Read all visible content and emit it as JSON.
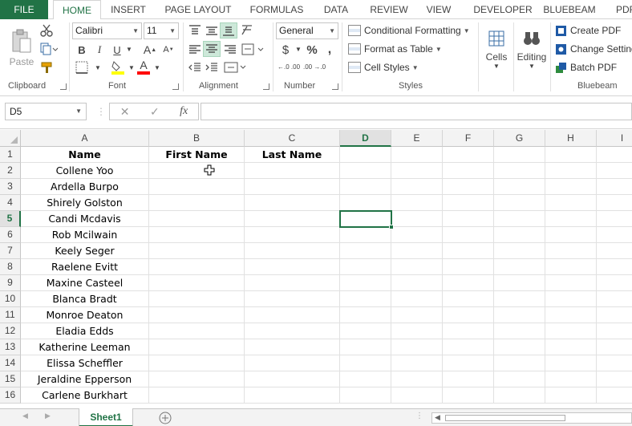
{
  "ribbon_tabs": [
    "FILE",
    "HOME",
    "INSERT",
    "PAGE LAYOUT",
    "FORMULAS",
    "DATA",
    "REVIEW",
    "VIEW",
    "DEVELOPER",
    "BLUEBEAM",
    "PDF"
  ],
  "active_tab": "HOME",
  "clipboard": {
    "paste_label": "Paste",
    "group_label": "Clipboard"
  },
  "font": {
    "name": "Calibri",
    "size": "11",
    "group_label": "Font",
    "bold": "B",
    "italic": "I",
    "underline": "U",
    "grow": "A",
    "fill_color": "#ffff00",
    "font_color": "#ff0000"
  },
  "alignment": {
    "group_label": "Alignment"
  },
  "number": {
    "format": "General",
    "currency": "$",
    "percent": "%",
    "comma": ",",
    "inc_dec": "←.0 .00",
    "dec_dec": ".00 →.0",
    "group_label": "Number"
  },
  "styles": {
    "conditional": "Conditional Formatting",
    "table": "Format as Table",
    "cell_styles": "Cell Styles",
    "group_label": "Styles"
  },
  "cells": {
    "label": "Cells"
  },
  "editing": {
    "label": "Editing"
  },
  "bluebeam": {
    "create": "Create PDF",
    "change": "Change Settings",
    "batch": "Batch PDF",
    "group_label": "Bluebeam"
  },
  "formula_bar": {
    "name_box": "D5",
    "cancel": "✕",
    "enter": "✓",
    "fx": "fx",
    "value": ""
  },
  "columns": [
    "A",
    "B",
    "C",
    "D",
    "E",
    "F",
    "G",
    "H",
    "I"
  ],
  "active_column": "D",
  "active_row": "5",
  "rows": [
    {
      "num": "1",
      "a": "Name",
      "b": "First Name",
      "c": "Last Name"
    },
    {
      "num": "2",
      "a": "Collene Yoo",
      "b": "",
      "c": ""
    },
    {
      "num": "3",
      "a": "Ardella Burpo",
      "b": "",
      "c": ""
    },
    {
      "num": "4",
      "a": "Shirely Golston",
      "b": "",
      "c": ""
    },
    {
      "num": "5",
      "a": "Candi Mcdavis",
      "b": "",
      "c": ""
    },
    {
      "num": "6",
      "a": "Rob Mcilwain",
      "b": "",
      "c": ""
    },
    {
      "num": "7",
      "a": "Keely Seger",
      "b": "",
      "c": ""
    },
    {
      "num": "8",
      "a": "Raelene Evitt",
      "b": "",
      "c": ""
    },
    {
      "num": "9",
      "a": "Maxine Casteel",
      "b": "",
      "c": ""
    },
    {
      "num": "10",
      "a": "Blanca Bradt",
      "b": "",
      "c": ""
    },
    {
      "num": "11",
      "a": "Monroe Deaton",
      "b": "",
      "c": ""
    },
    {
      "num": "12",
      "a": "Eladia Edds",
      "b": "",
      "c": ""
    },
    {
      "num": "13",
      "a": "Katherine Leeman",
      "b": "",
      "c": ""
    },
    {
      "num": "14",
      "a": "Elissa Scheffler",
      "b": "",
      "c": ""
    },
    {
      "num": "15",
      "a": "Jeraldine Epperson",
      "b": "",
      "c": ""
    },
    {
      "num": "16",
      "a": "Carlene Burkhart",
      "b": "",
      "c": ""
    }
  ],
  "sheet_tab": "Sheet1",
  "accent_color": "#217346"
}
